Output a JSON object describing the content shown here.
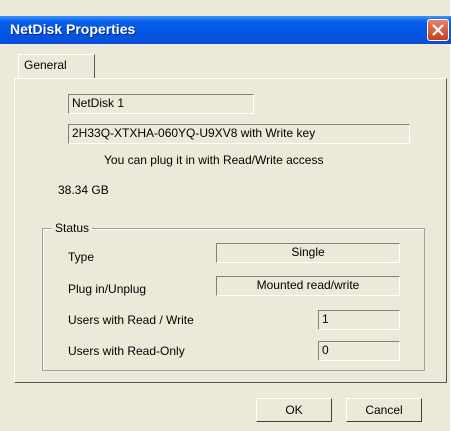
{
  "window": {
    "title": "NetDisk Properties"
  },
  "tabs": [
    {
      "label": "General"
    }
  ],
  "general": {
    "name": "NetDisk 1",
    "key": "2H33Q-XTXHA-060YQ-U9XV8  with Write key",
    "access_note": "You can plug it in with Read/Write access",
    "capacity": "38.34 GB"
  },
  "status": {
    "title": "Status",
    "type_label": "Type",
    "type_value": "Single",
    "plug_label": "Plug in/Unplug",
    "plug_value": "Mounted read/write",
    "rw_label": "Users with Read / Write",
    "rw_value": "1",
    "ro_label": "Users with Read-Only",
    "ro_value": "0"
  },
  "buttons": {
    "ok": "OK",
    "cancel": "Cancel"
  },
  "colors": {
    "title_bar": "#0055e5",
    "dialog_bg": "#ece9d8",
    "close_button": "#c6401f"
  }
}
